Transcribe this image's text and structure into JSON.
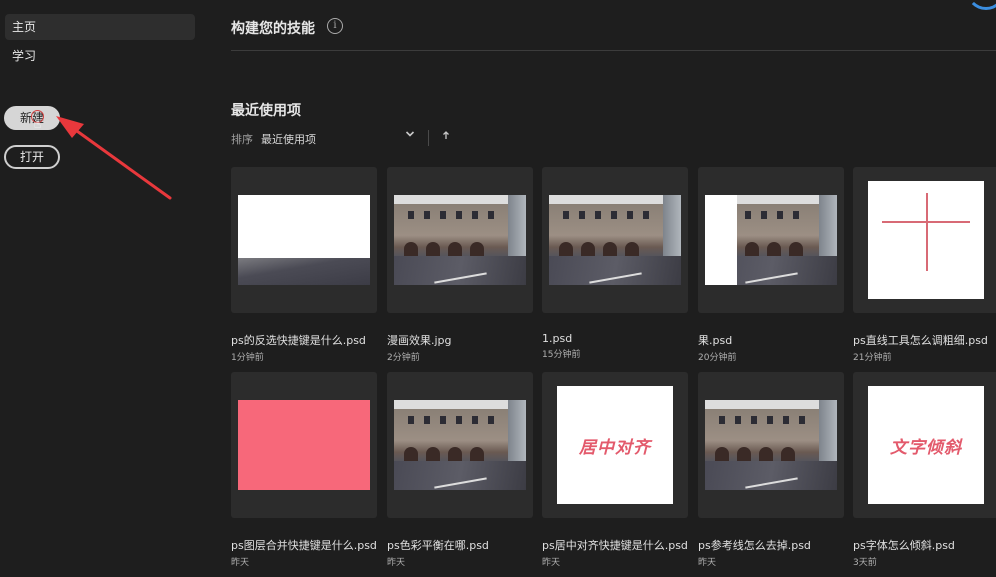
{
  "sidebar": {
    "items": [
      {
        "label": "主页"
      },
      {
        "label": "学习"
      }
    ],
    "new_button": "新建",
    "open_button": "打开"
  },
  "header": {
    "title": "构建您的技能",
    "info_icon": "i"
  },
  "recent": {
    "title": "最近使用项",
    "sort_label": "排序",
    "sort_value": "最近使用项",
    "sort_chevron": "chevron-down-icon",
    "sort_direction_icon": "arrow-up-icon"
  },
  "files": [
    {
      "name": "ps的反选快捷键是什么.psd",
      "time": "1分钟前",
      "thumb": "white-road"
    },
    {
      "name": "漫画效果.jpg",
      "time": "2分钟前",
      "thumb": "street"
    },
    {
      "name": "1.psd",
      "time": "15分钟前",
      "thumb": "street"
    },
    {
      "name": "果.psd",
      "time": "20分钟前",
      "thumb": "street-white-left"
    },
    {
      "name": "ps直线工具怎么调粗细.psd",
      "time": "21分钟前",
      "thumb": "cross"
    },
    {
      "name": "ps图层合并快捷键是什么.psd",
      "time": "昨天",
      "thumb": "pink"
    },
    {
      "name": "ps色彩平衡在哪.psd",
      "time": "昨天",
      "thumb": "street"
    },
    {
      "name": "ps居中对齐快捷键是什么.psd",
      "time": "昨天",
      "thumb": "text",
      "art": "居中对齐"
    },
    {
      "name": "ps参考线怎么去掉.psd",
      "time": "昨天",
      "thumb": "street"
    },
    {
      "name": "ps字体怎么倾斜.psd",
      "time": "3天前",
      "thumb": "text",
      "art": "文字倾斜"
    }
  ],
  "colors": {
    "background": "#1e1e1e",
    "card": "#2c2c2c",
    "accent_pink": "#f7687a",
    "annotation_red": "#e8383c",
    "ring_blue": "#3b8ee0"
  }
}
